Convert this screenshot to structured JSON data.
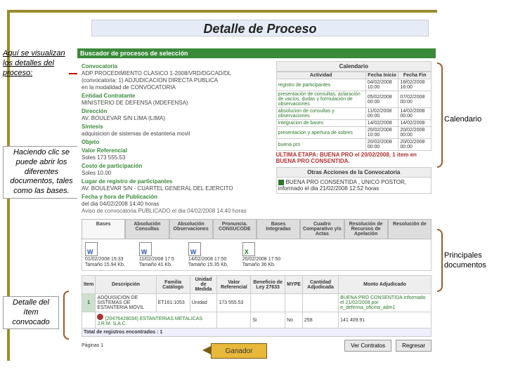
{
  "slide_title": "Detalle de Proceso",
  "annotations": {
    "intro": "Aquí se visualizan los detalles del proceso:",
    "calendario": "Calendario",
    "click_docs": "Haciendo clic se puede abrir los diferentes documentos, tales como las bases.",
    "principales_docs": "Principales documentos",
    "detalle_item": "Detalle del ítem convocado",
    "ganador": "Ganador"
  },
  "app": {
    "header": "Buscador de procesos de selección",
    "convocatoria": {
      "label": "Convocatoria",
      "line1": "ADP PROCEDIMIENTO CLASICO 1-2008/VRD/DGCAD/DL",
      "line2": "(convocatoria: 1) ADJUDICACION DIRECTA PUBLICA",
      "line3": "en la modalidad de CONVOCATORIA",
      "entidad_label": "Entidad Contratante",
      "entidad": "MINISTERIO DE DEFENSA (MDEFENSA)",
      "direccion_label": "Dirección",
      "direccion": "AV. BOULEVAR S/N LIMA (LIMA)",
      "sintesis_label": "Síntesis",
      "sintesis": "adquisicion de sistemas de estanteria movil",
      "objeto_label": "Objeto",
      "valor_ref_label": "Valor Referencial",
      "valor_ref": "Soles  173  555.53",
      "costo_label": "Costo de participación",
      "costo": "Soles  10.00",
      "lugar_label": "Lugar de registro de participantes",
      "lugar": "AV. BOULEVAR S/N - CUARTEL GENERAL DEL EJERCITO",
      "fecha_label": "Fecha y hora de Publicación",
      "fecha": "del dia 04/02/2008 14:40 horas",
      "aviso": "Aviso de convocatoria PUBLICADO el dia 04/02/2008 14:40 horas"
    },
    "calendario": {
      "title": "Calendario",
      "headers": [
        "Actividad",
        "Fecha Inicio",
        "Fecha Fin"
      ],
      "rows": [
        {
          "act": "registro de participantes",
          "ini": "04/02/2008 10:00",
          "fin": "18/02/2008 16:00"
        },
        {
          "act": "presentación de consultas, aclaración de vacíos, dudas y formulación de observaciones",
          "ini": "05/02/2008 00:00",
          "fin": "07/02/2008 00:00"
        },
        {
          "act": "absolucion de consultas y observaciones",
          "ini": "11/02/2008 00:00",
          "fin": "14/02/2008 00:00"
        },
        {
          "act": "integracion de bases",
          "ini": "14/02/2008",
          "fin": "14/02/2008"
        },
        {
          "act": "presentacion y apertura de sobres",
          "ini": "20/02/2008 10:00",
          "fin": "20/02/2008 00:00"
        },
        {
          "act": "buena pro",
          "ini": "20/02/2008 00:00",
          "fin": "20/02/2008 00:00"
        }
      ],
      "alert": "ULTIMA ETAPA: BUENA PRO el 20/02/2008, 1 item en BUENA PRO CONSENTIDA."
    },
    "otras": {
      "title": "Otras Acciones de la Convocatoria",
      "row": "BUENA PRO CONSENTIDA , UNICO POSTOR, informado el dia 21/02/2008 12:52 horas"
    },
    "tabs": [
      "Bases",
      "Absolución Consultas",
      "Absolución Observaciones",
      "Pronuncia. CONSUCODE",
      "Bases Integradas",
      "Cuadro Comparativo y/o Actas",
      "Resolución de Recursos de Apelación",
      "Resolución de"
    ],
    "docs": [
      {
        "date": "01/02/2008 15:33",
        "size": "Tamaño 15.94 Kb.",
        "type": "word"
      },
      {
        "date": "11/02/2008 17:5",
        "size": "Tamaño 41 Kb.",
        "type": "word"
      },
      {
        "date": "14/02/2008 17:50",
        "size": "Tamaño 15.35 Kb.",
        "type": "word"
      },
      {
        "date": "20/02/2008 17:50",
        "size": "Tamaño 36 Kb.",
        "type": "excel"
      }
    ],
    "item_table": {
      "headers": [
        "Item",
        "Descripción",
        "Familia Catálogo",
        "Unidad de Medida",
        "Valor Referencial",
        "Beneficio de Ley 27633",
        "MYPE",
        "Cantidad Adjudicada",
        "Monto Adjudicado"
      ],
      "row": {
        "item": "1",
        "desc": "ADQUISICION DE SISTEMAS DE ESTANTERIA MOVIL",
        "familia": "ET161:1053",
        "unidad": "Unidad",
        "valor": "173 555.53",
        "beneficio": "",
        "mype": "",
        "cant": "",
        "monto": "BUENA PRO CONSENTIDA informado el 21/02/2008 por e_defensa_oficina_adm1"
      },
      "ganador_row": {
        "ruc": "(20476428034) ESTANTERIAS METALICAS J.R.M. S.A.C",
        "col1": "Si",
        "col2": "No",
        "cant": "258",
        "monto": "141 409.91"
      },
      "total": "Total de registros encontrados : 1"
    },
    "footer": {
      "paginas": "Páginas  1",
      "btn1": "Ver Contratos",
      "btn2": "Regresar"
    }
  }
}
